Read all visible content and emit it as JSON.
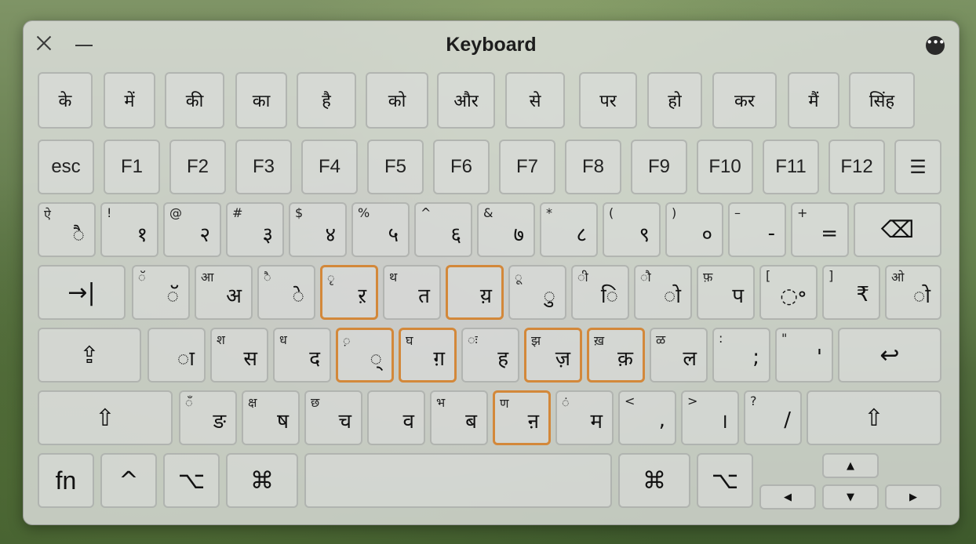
{
  "window": {
    "title": "Keyboard",
    "more_label": "•••"
  },
  "candidates": [
    "के",
    "में",
    "की",
    "का",
    "है",
    "को",
    "और",
    "से",
    "पर",
    "हो",
    "कर",
    "मैं",
    "सिंह"
  ],
  "fkeys": [
    "esc",
    "F1",
    "F2",
    "F3",
    "F4",
    "F5",
    "F6",
    "F7",
    "F8",
    "F9",
    "F10",
    "F11",
    "F12",
    "☰"
  ],
  "number_row": [
    {
      "shift": "ऐ",
      "main": "◌ै"
    },
    {
      "shift": "!",
      "main": "१"
    },
    {
      "shift": "@",
      "main": "२"
    },
    {
      "shift": "#",
      "main": "३"
    },
    {
      "shift": "$",
      "main": "४"
    },
    {
      "shift": "%",
      "main": "५"
    },
    {
      "shift": "^",
      "main": "६"
    },
    {
      "shift": "&",
      "main": "७"
    },
    {
      "shift": "*",
      "main": "८"
    },
    {
      "shift": "(",
      "main": "९"
    },
    {
      "shift": ")",
      "main": "०"
    },
    {
      "shift": "–",
      "main": "-"
    },
    {
      "shift": "+",
      "main": "="
    },
    {
      "shift": "",
      "main": "⌫"
    }
  ],
  "qwerty_row": [
    {
      "shift": "",
      "main": "→|"
    },
    {
      "shift": "◌ॅ",
      "main": "◌ॅ"
    },
    {
      "shift": "आ",
      "main": "अ"
    },
    {
      "shift": "◌ै",
      "main": "◌े"
    },
    {
      "shift": "◌ृ",
      "main": "ऱ"
    },
    {
      "shift": "थ",
      "main": "त"
    },
    {
      "shift": "",
      "main": "य़"
    },
    {
      "shift": "◌ू",
      "main": "◌ु"
    },
    {
      "shift": "◌ी",
      "main": "◌ि"
    },
    {
      "shift": "◌ौ",
      "main": "◌ो"
    },
    {
      "shift": "फ़",
      "main": "प"
    },
    {
      "shift": "[",
      "main": "◌॰"
    },
    {
      "shift": "]",
      "main": "₹"
    },
    {
      "shift": "ओ",
      "main": "◌ो"
    }
  ],
  "asdf_row": [
    {
      "shift": "",
      "main": "⇪"
    },
    {
      "shift": "",
      "main": "◌ा"
    },
    {
      "shift": "श",
      "main": "स"
    },
    {
      "shift": "ध",
      "main": "द"
    },
    {
      "shift": "◌़",
      "main": "◌्"
    },
    {
      "shift": "घ",
      "main": "ग़"
    },
    {
      "shift": "◌ः",
      "main": "ह"
    },
    {
      "shift": "झ",
      "main": "ज़"
    },
    {
      "shift": "ख़",
      "main": "क़"
    },
    {
      "shift": "ळ",
      "main": "ल"
    },
    {
      "shift": ":",
      "main": ";"
    },
    {
      "shift": "\"",
      "main": "'"
    },
    {
      "shift": "",
      "main": "↩"
    }
  ],
  "zxcv_row": [
    {
      "shift": "",
      "main": "⇧"
    },
    {
      "shift": "◌ँ",
      "main": "ङ"
    },
    {
      "shift": "क्ष",
      "main": "ष"
    },
    {
      "shift": "छ",
      "main": "च"
    },
    {
      "shift": "",
      "main": "व"
    },
    {
      "shift": "भ",
      "main": "ब"
    },
    {
      "shift": "ण",
      "main": "ऩ"
    },
    {
      "shift": "◌ं",
      "main": "म"
    },
    {
      "shift": "<",
      "main": ","
    },
    {
      "shift": ">",
      "main": "।"
    },
    {
      "shift": "?",
      "main": "/"
    },
    {
      "shift": "",
      "main": "⇧"
    }
  ],
  "bottom_row": {
    "fn": "fn",
    "control": "^",
    "option_left": "⌥",
    "command_left": "⌘",
    "space": "",
    "command_right": "⌘",
    "option_right": "⌥",
    "arrow_up": "▲",
    "arrow_left": "◀",
    "arrow_down": "▼",
    "arrow_right": "▶"
  },
  "highlight_color": "#d3883a"
}
